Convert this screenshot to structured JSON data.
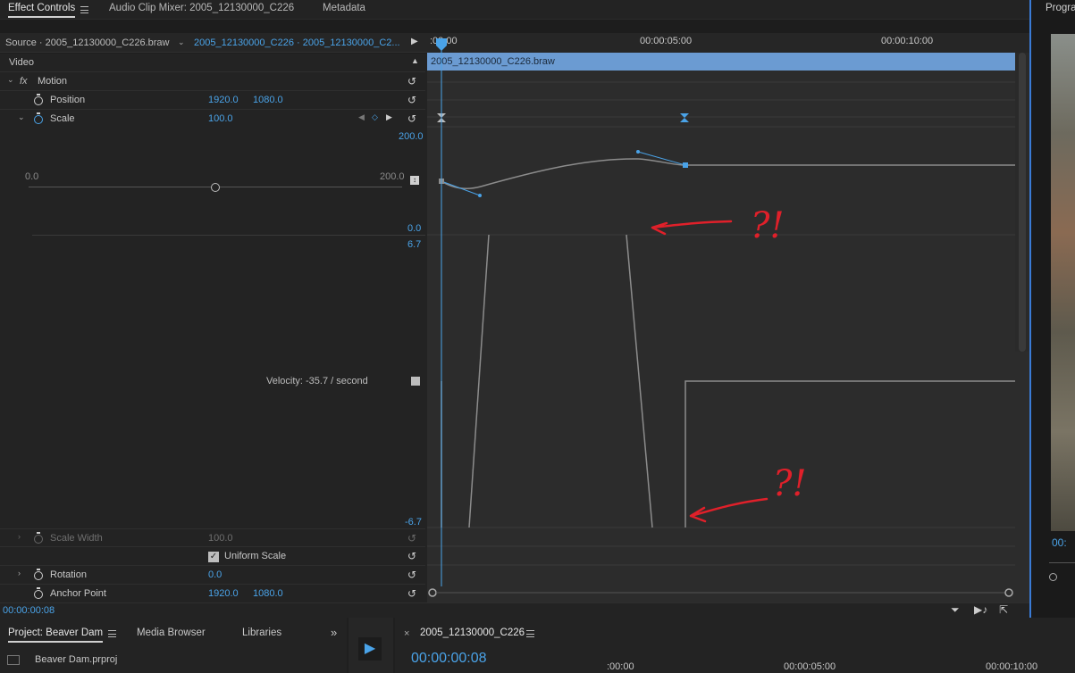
{
  "tabs": {
    "effect_controls": "Effect Controls",
    "audio_clip_mixer": "Audio Clip Mixer: 2005_12130000_C226",
    "metadata": "Metadata",
    "program_partial": "Progra"
  },
  "source_bar": {
    "source": "Source · 2005_12130000_C226.braw",
    "sequence": "2005_12130000_C226 · 2005_12130000_C2..."
  },
  "ruler": {
    "t0": ":00:00",
    "t5": "00:00:05:00",
    "t10": "00:00:10:00"
  },
  "clip_label": "2005_12130000_C226.braw",
  "section": "Video",
  "motion": {
    "label": "Motion",
    "fx": "fx",
    "position": {
      "label": "Position",
      "x": "1920.0",
      "y": "1080.0"
    },
    "scale": {
      "label": "Scale",
      "value": "100.0",
      "slider_min": "0.0",
      "slider_max": "200.0",
      "slider_value": 0.5,
      "graph_top": "200.0",
      "graph_bottom": "0.0",
      "velocity_top": "6.7",
      "velocity_bottom": "-6.7",
      "velocity_readout": "Velocity: -35.7 / second"
    },
    "scale_width": {
      "label": "Scale Width",
      "value": "100.0"
    },
    "uniform_scale": {
      "label": "Uniform Scale",
      "checked": true
    },
    "rotation": {
      "label": "Rotation",
      "value": "0.0"
    },
    "anchor_point": {
      "label": "Anchor Point",
      "x": "1920.0",
      "y": "1080.0"
    }
  },
  "current_time": "00:00:00:08",
  "annotations": {
    "note1": "?!",
    "note2": "?!"
  },
  "bottom": {
    "project_tab": "Project: Beaver Dam",
    "media_browser": "Media Browser",
    "libraries": "Libraries",
    "project_file": "Beaver Dam.prproj",
    "sequence_tab": "2005_12130000_C226",
    "seq_time": "00:00:00:08",
    "ruler_t0": ":00:00",
    "ruler_t5": "00:00:05:00",
    "ruler_t10": "00:00:10:00"
  },
  "program_time_partial": "00:",
  "colors": {
    "accent": "#4aa3e8",
    "clip_bar": "#6b9bd2",
    "annotation": "#e0202a",
    "curve": "#8c8c8c"
  }
}
